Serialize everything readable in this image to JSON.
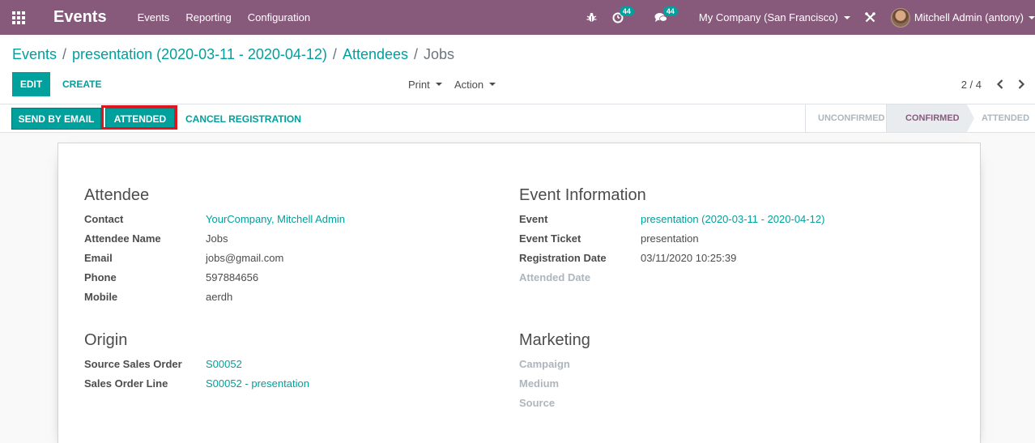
{
  "navbar": {
    "app_title": "Events",
    "menu": [
      "Events",
      "Reporting",
      "Configuration"
    ],
    "activity_count": "44",
    "messages_count": "44",
    "company": "My Company (San Francisco)",
    "user": "Mitchell Admin (antony)"
  },
  "breadcrumb": [
    "Events",
    "presentation (2020-03-11 - 2020-04-12)",
    "Attendees",
    "Jobs"
  ],
  "toolbar": {
    "edit_label": "EDIT",
    "create_label": "CREATE",
    "print_label": "Print",
    "action_label": "Action"
  },
  "pager": {
    "value": "2 / 4"
  },
  "statusbar": {
    "send_email_label": "SEND BY EMAIL",
    "attended_label": "ATTENDED",
    "cancel_label": "CANCEL REGISTRATION",
    "stages": [
      "UNCONFIRMED",
      "CONFIRMED",
      "ATTENDED"
    ],
    "current_stage": "CONFIRMED"
  },
  "attendee": {
    "title": "Attendee",
    "fields": [
      {
        "label": "Contact",
        "value": "YourCompany, Mitchell Admin"
      },
      {
        "label": "Attendee Name",
        "value": "Jobs"
      },
      {
        "label": "Email",
        "value": "jobs@gmail.com"
      },
      {
        "label": "Phone",
        "value": "597884656"
      },
      {
        "label": "Mobile",
        "value": "aerdh"
      }
    ]
  },
  "event_info": {
    "title": "Event Information",
    "fields": [
      {
        "label": "Event",
        "value": "presentation (2020-03-11 - 2020-04-12)"
      },
      {
        "label": "Event Ticket",
        "value": "presentation"
      },
      {
        "label": "Registration Date",
        "value": "03/11/2020 10:25:39"
      },
      {
        "label": "Attended Date",
        "value": ""
      }
    ]
  },
  "origin": {
    "title": "Origin",
    "fields": [
      {
        "label": "Source Sales Order",
        "value": "S00052"
      },
      {
        "label": "Sales Order Line",
        "value": "S00052 - presentation"
      }
    ]
  },
  "marketing": {
    "title": "Marketing",
    "fields": [
      {
        "label": "Campaign",
        "value": ""
      },
      {
        "label": "Medium",
        "value": ""
      },
      {
        "label": "Source",
        "value": ""
      }
    ]
  },
  "colors": {
    "navbar": "#875a7b",
    "primary": "#00a09d",
    "highlight": "#e0161e"
  }
}
